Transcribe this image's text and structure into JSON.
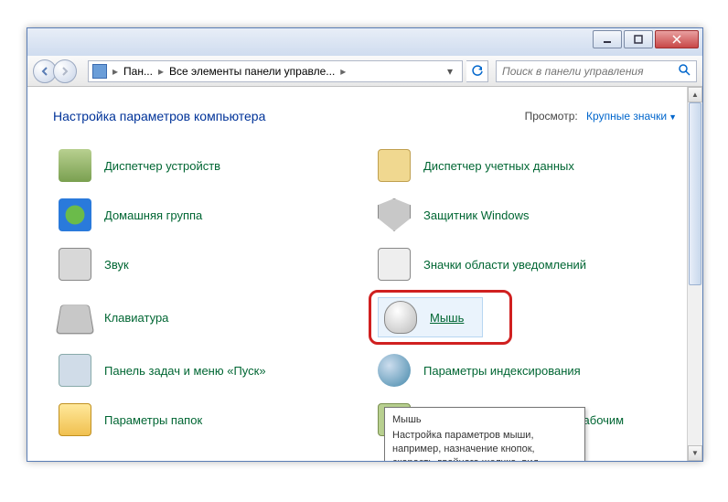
{
  "titlebar": {},
  "nav": {
    "crumb1": "Пан...",
    "crumb2": "Все элементы панели управле...",
    "search_placeholder": "Поиск в панели управления"
  },
  "header": {
    "title": "Настройка параметров компьютера",
    "view_label": "Просмотр:",
    "view_value": "Крупные значки"
  },
  "items": {
    "devmgr": "Диспетчер устройств",
    "accounts": "Диспетчер учетных данных",
    "homegrp": "Домашняя группа",
    "defender": "Защитник Windows",
    "sound": "Звук",
    "notify": "Значки области уведомлений",
    "keyboard": "Клавиатура",
    "mouse": "Мышь",
    "taskbar": "Панель задач и меню «Пуск»",
    "index": "Параметры индексирования",
    "folders": "Параметры папок",
    "remote": "Подключение к удаленным рабочим"
  },
  "tooltip": {
    "title": "Мышь",
    "body": "Настройка параметров мыши, например, назначение кнопок, скорость двойного щелчка, вид указателя и скорость перемещения."
  }
}
